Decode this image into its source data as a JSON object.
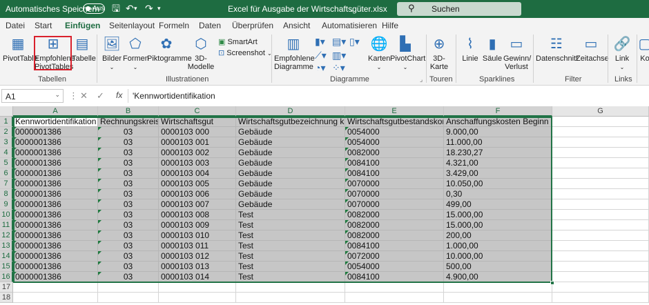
{
  "titlebar": {
    "autosave_label": "Automatisches Speichern",
    "autosave_state": "Aus",
    "save_icon": "save-icon",
    "undo_icon": "undo-icon",
    "redo_icon": "redo-icon",
    "title": "Excel für Ausgabe der Wirtschaftsgüter.xlsx",
    "search_placeholder": "Suchen",
    "accent_color": "#1e6c41"
  },
  "tabs": [
    "Datei",
    "Start",
    "Einfügen",
    "Seitenlayout",
    "Formeln",
    "Daten",
    "Überprüfen",
    "Ansicht",
    "Automatisieren",
    "Hilfe"
  ],
  "active_tab": "Einfügen",
  "ribbon": {
    "groups": {
      "tabellen": "Tabellen",
      "illustrationen": "Illustrationen",
      "diagramme": "Diagramme",
      "touren": "Touren",
      "sparklines": "Sparklines",
      "filter": "Filter",
      "links": "Links"
    },
    "buttons": {
      "pivottable": "PivotTable",
      "empfohlene_pivot_1": "Empfohlene",
      "empfohlene_pivot_2": "PivotTables",
      "tabelle": "Tabelle",
      "bilder": "Bilder",
      "formen": "Formen",
      "piktogramme": "Piktogramme",
      "modelle_1": "3D-",
      "modelle_2": "Modelle",
      "smartart": "SmartArt",
      "screenshot": "Screenshot",
      "empf_diagramme_1": "Empfohlene",
      "empf_diagramme_2": "Diagramme",
      "karten": "Karten",
      "pivotchart": "PivotChart",
      "karte3d_1": "3D-",
      "karte3d_2": "Karte",
      "linie": "Linie",
      "saeule": "Säule",
      "gewinn_1": "Gewinn/",
      "gewinn_2": "Verlust",
      "datenschnitt": "Datenschnitt",
      "zeitachse": "Zeitachse",
      "link": "Link",
      "ko": "Ko"
    }
  },
  "formula_bar": {
    "name_box": "A1",
    "fx": "fx",
    "formula": "'Kennwortidentifikation"
  },
  "grid": {
    "columns": [
      "A",
      "B",
      "C",
      "D",
      "E",
      "F",
      "G"
    ],
    "rows": [
      "1",
      "2",
      "3",
      "4",
      "5",
      "6",
      "7",
      "8",
      "9",
      "10",
      "11",
      "12",
      "13",
      "14",
      "15",
      "16",
      "17",
      "18"
    ],
    "header_row": [
      "Kennwortidentifikation",
      "Rechnungskreis",
      "Wirtschaftsgut",
      "Wirtschaftsgutbezeichnung kurz",
      "Wirtschaftsgutbestandskonto",
      "Anschaffungskosten Beginn"
    ],
    "data_rows": [
      [
        "0000001386",
        "03",
        "0000103 000",
        "Gebäude",
        "0054000",
        "9.000,00"
      ],
      [
        "0000001386",
        "03",
        "0000103 001",
        "Gebäude",
        "0054000",
        "11.000,00"
      ],
      [
        "0000001386",
        "03",
        "0000103 002",
        "Gebäude",
        "0082000",
        "18.230,27"
      ],
      [
        "0000001386",
        "03",
        "0000103 003",
        "Gebäude",
        "0084100",
        "4.321,00"
      ],
      [
        "0000001386",
        "03",
        "0000103 004",
        "Gebäude",
        "0084100",
        "3.429,00"
      ],
      [
        "0000001386",
        "03",
        "0000103 005",
        "Gebäude",
        "0070000",
        "10.050,00"
      ],
      [
        "0000001386",
        "03",
        "0000103 006",
        "Gebäude",
        "0070000",
        "0,30"
      ],
      [
        "0000001386",
        "03",
        "0000103 007",
        "Gebäude",
        "0070000",
        "499,00"
      ],
      [
        "0000001386",
        "03",
        "0000103 008",
        "Test",
        "0082000",
        "15.000,00"
      ],
      [
        "0000001386",
        "03",
        "0000103 009",
        "Test",
        "0082000",
        "15.000,00"
      ],
      [
        "0000001386",
        "03",
        "0000103 010",
        "Test",
        "0082000",
        "200,00"
      ],
      [
        "0000001386",
        "03",
        "0000103 011",
        "Test",
        "0084100",
        "1.000,00"
      ],
      [
        "0000001386",
        "03",
        "0000103 012",
        "Test",
        "0072000",
        "10.000,00"
      ],
      [
        "0000001386",
        "03",
        "0000103 013",
        "Test",
        "0054000",
        "500,00"
      ],
      [
        "0000001386",
        "03",
        "0000103 014",
        "Test",
        "0084100",
        "4.900,00"
      ]
    ]
  }
}
